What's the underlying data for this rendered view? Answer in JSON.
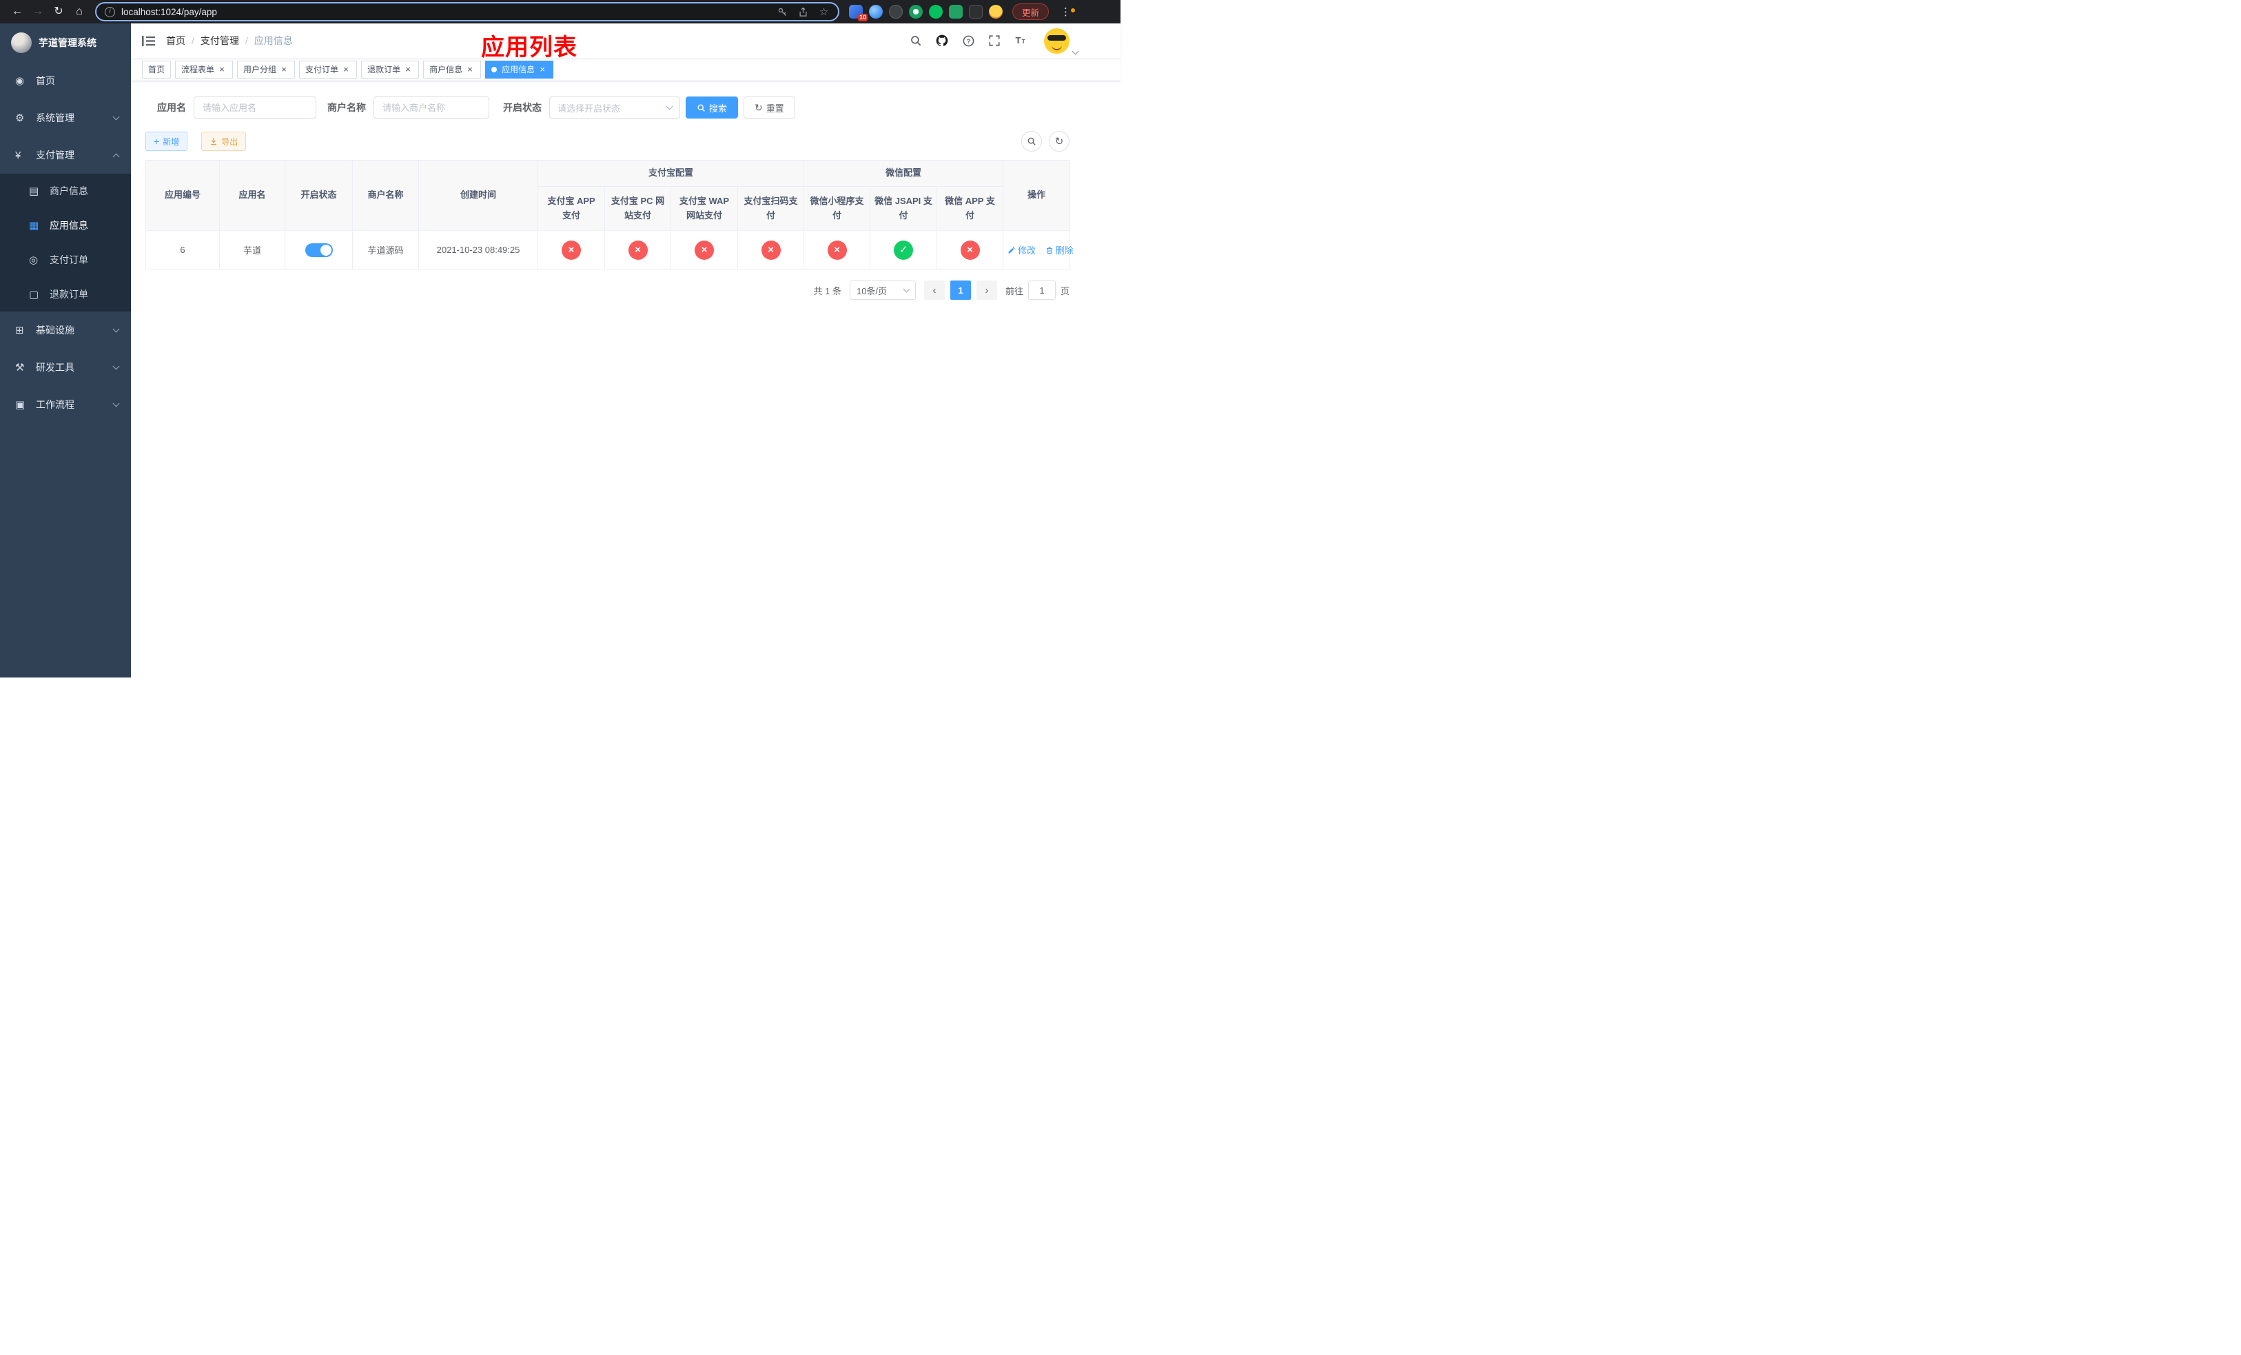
{
  "browser": {
    "url": "localhost:1024/pay/app",
    "update_label": "更新",
    "extension_badge": "10"
  },
  "icons": {
    "back": "←",
    "forward": "→",
    "reload": "↻",
    "home": "⌂",
    "info": "i",
    "star": "☆",
    "kebab": "⋮",
    "close": "×",
    "plus": "+",
    "refresh": "↻",
    "prev": "‹",
    "next": "›"
  },
  "sidebar": {
    "title": "芋道管理系统",
    "items": [
      {
        "icon": "◉",
        "label": "首页"
      },
      {
        "icon": "⚙",
        "label": "系统管理"
      },
      {
        "icon": "¥",
        "label": "支付管理"
      },
      {
        "icon": "⊞",
        "label": "基础设施"
      },
      {
        "icon": "⚒",
        "label": "研发工具"
      },
      {
        "icon": "▣",
        "label": "工作流程"
      }
    ],
    "submenu": [
      {
        "icon": "▤",
        "label": "商户信息"
      },
      {
        "icon": "▦",
        "label": "应用信息",
        "active": true
      },
      {
        "icon": "◎",
        "label": "支付订单"
      },
      {
        "icon": "▢",
        "label": "退款订单"
      }
    ]
  },
  "header": {
    "breadcrumb": [
      "首页",
      "支付管理",
      "应用信息"
    ],
    "separator": "/",
    "page_title": "应用列表"
  },
  "tabs": [
    {
      "label": "首页",
      "closable": false,
      "active": false
    },
    {
      "label": "流程表单",
      "closable": true,
      "active": false
    },
    {
      "label": "用户分组",
      "closable": true,
      "active": false
    },
    {
      "label": "支付订单",
      "closable": true,
      "active": false
    },
    {
      "label": "退款订单",
      "closable": true,
      "active": false
    },
    {
      "label": "商户信息",
      "closable": true,
      "active": false
    },
    {
      "label": "应用信息",
      "closable": true,
      "active": true
    }
  ],
  "filters": {
    "app_name": {
      "label": "应用名",
      "placeholder": "请输入应用名",
      "value": ""
    },
    "merchant_name": {
      "label": "商户名称",
      "placeholder": "请输入商户名称",
      "value": ""
    },
    "status": {
      "label": "开启状态",
      "placeholder": "请选择开启状态",
      "value": ""
    },
    "search_label": "搜索",
    "reset_label": "重置"
  },
  "toolbar": {
    "add_label": "新增",
    "export_label": "导出"
  },
  "table": {
    "columns": {
      "app_id": "应用编号",
      "app_name": "应用名",
      "status": "开启状态",
      "merchant": "商户名称",
      "created": "创建时间",
      "actions": "操作"
    },
    "groups": [
      {
        "label": "支付宝配置",
        "columns": [
          "支付宝 APP 支付",
          "支付宝 PC 网站支付",
          "支付宝 WAP 网站支付",
          "支付宝扫码支付"
        ]
      },
      {
        "label": "微信配置",
        "columns": [
          "微信小程序支付",
          "微信 JSAPI 支付",
          "微信 APP 支付"
        ]
      }
    ],
    "row": {
      "app_id": "6",
      "app_name": "芋道",
      "status_on": true,
      "merchant": "芋道源码",
      "created": "2021-10-23 08:49:25",
      "channel_statuses": [
        "fail",
        "fail",
        "fail",
        "fail",
        "fail",
        "pass",
        "fail"
      ],
      "edit_label": "修改",
      "delete_label": "删除"
    }
  },
  "pagination": {
    "total": "共 1 条",
    "page_size": "10条/页",
    "page": "1",
    "goto_label": "前往",
    "goto_value": "1",
    "goto_unit": "页"
  },
  "colors": {
    "accent": "#409eff",
    "danger": "#f85a5a",
    "success": "#13ce66",
    "warning": "#e6a23c",
    "title_red": "#fe0000",
    "sidebar_bg": "#304156",
    "submenu_bg": "#1f2d3d"
  }
}
